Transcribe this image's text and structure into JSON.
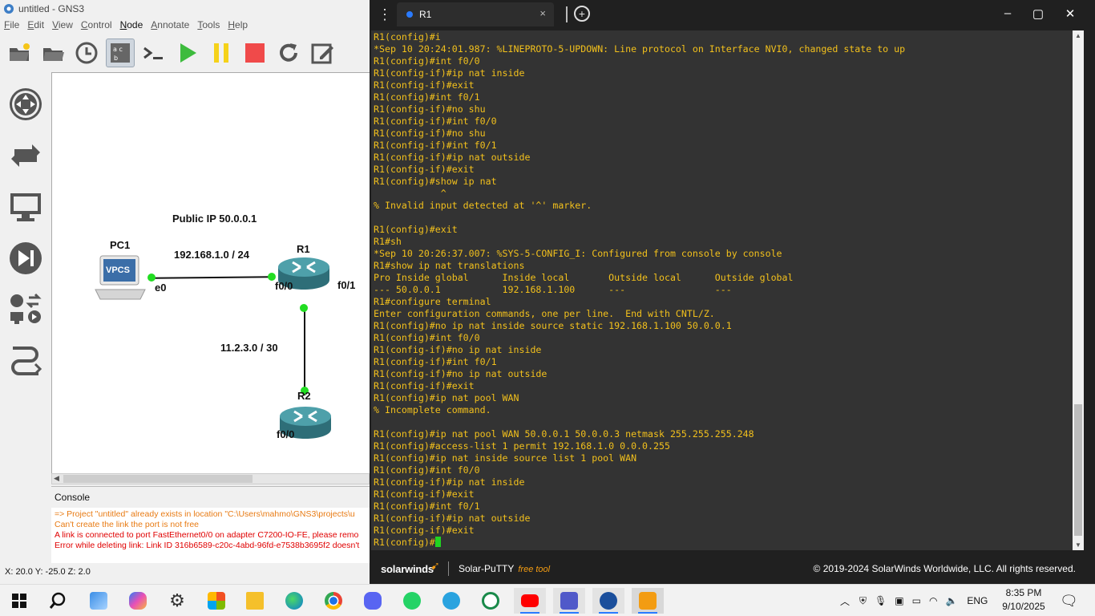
{
  "gns3": {
    "title": "untitled - GNS3",
    "menu": [
      "File",
      "Edit",
      "View",
      "Control",
      "Node",
      "Annotate",
      "Tools",
      "Help"
    ],
    "toolbar": [
      "open-folder",
      "open-project",
      "snapshot",
      "show-names",
      "console",
      "start",
      "suspend",
      "stop",
      "reload",
      "annotate"
    ],
    "topology": {
      "pc_label": "PC1",
      "pc_icon_text": "VPCS",
      "pc_port": "e0",
      "r1_label": "R1",
      "r1_port_left": "f0/0",
      "r1_port_right": "f0/1",
      "r2_label": "R2",
      "r2_port": "f0/0",
      "note_public": "Public IP 50.0.0.1",
      "note_lan": "192.168.1.0 / 24",
      "note_wan": "11.2.3.0 / 30"
    },
    "console": {
      "header": "Console",
      "lines": [
        {
          "text": "=> Project \"untitled\" already exists in location \"C:\\Users\\mahmo\\GNS3\\projects\\u",
          "color": "#e87b14"
        },
        {
          "text": "Can't create the link the port is not free",
          "color": "#e87b14"
        },
        {
          "text": "A link is connected to port FastEthernet0/0 on adapter C7200-IO-FE, please remo",
          "color": "#e00000"
        },
        {
          "text": "Error while deleting link: Link ID 316b6589-c20c-4abd-96fd-e7538b3695f2 doesn't",
          "color": "#e00000"
        }
      ]
    },
    "coords": "X: 20.0 Y: -25.0 Z: 2.0"
  },
  "putty": {
    "tab_label": "R1",
    "tab_close": "×",
    "new_tab": "+",
    "minimize": "–",
    "maximize": "▢",
    "close": "✕",
    "terminal_lines": [
      "R1(config)#i",
      "*Sep 10 20:24:01.987: %LINEPROTO-5-UPDOWN: Line protocol on Interface NVI0, changed state to up",
      "R1(config)#int f0/0",
      "R1(config-if)#ip nat inside",
      "R1(config-if)#exit",
      "R1(config)#int f0/1",
      "R1(config-if)#no shu",
      "R1(config-if)#int f0/0",
      "R1(config-if)#no shu",
      "R1(config-if)#int f0/1",
      "R1(config-if)#ip nat outside",
      "R1(config-if)#exit",
      "R1(config)#show ip nat",
      "            ^",
      "% Invalid input detected at '^' marker.",
      "",
      "R1(config)#exit",
      "R1#sh",
      "*Sep 10 20:26:37.007: %SYS-5-CONFIG_I: Configured from console by console",
      "R1#show ip nat translations",
      "Pro Inside global      Inside local       Outside local      Outside global",
      "--- 50.0.0.1           192.168.1.100      ---                ---",
      "R1#configure terminal",
      "Enter configuration commands, one per line.  End with CNTL/Z.",
      "R1(config)#no ip nat inside source static 192.168.1.100 50.0.0.1",
      "R1(config)#int f0/0",
      "R1(config-if)#no ip nat inside",
      "R1(config-if)#int f0/1",
      "R1(config-if)#no ip nat outside",
      "R1(config-if)#exit",
      "R1(config)#ip nat pool WAN",
      "% Incomplete command.",
      "",
      "R1(config)#ip nat pool WAN 50.0.0.1 50.0.0.3 netmask 255.255.255.248",
      "R1(config)#access-list 1 permit 192.168.1.0 0.0.0.255",
      "R1(config)#ip nat inside source list 1 pool WAN",
      "R1(config)#int f0/0",
      "R1(config-if)#ip nat inside",
      "R1(config-if)#exit",
      "R1(config)#int f0/1",
      "R1(config-if)#ip nat outside",
      "R1(config-if)#exit"
    ],
    "prompt": "R1(config)#",
    "footer": {
      "brand": "solarwinds",
      "product": "Solar-PuTTY",
      "product_tag": "free tool",
      "copyright": "© 2019-2024 SolarWinds Worldwide, LLC. All rights reserved."
    }
  },
  "taskbar": {
    "apps": [
      "start-icon",
      "search-icon",
      "task-view-icon",
      "copilot-icon",
      "settings-icon",
      "store-icon",
      "file-explorer-icon",
      "edge-icon",
      "chrome-icon",
      "discord-icon",
      "whatsapp-icon",
      "telegram-icon",
      "gns3-icon",
      "youtube-icon",
      "teams-icon",
      "edge-dev-icon",
      "solar-putty-icon"
    ],
    "language": "ENG",
    "time": "8:35 PM",
    "date": "9/10/2025"
  },
  "colors": {
    "terminal_bg": "#333333",
    "terminal_text": "#f2c01c",
    "cursor": "#21d321",
    "link_dot": "#22dd22",
    "accent": "#2a7bff"
  }
}
